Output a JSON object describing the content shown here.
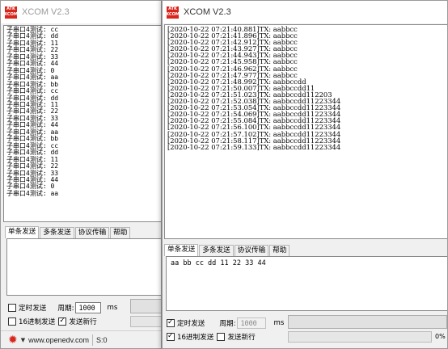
{
  "logo_text": "ATK\nXCOM",
  "window1": {
    "title": "XCOM V2.3",
    "receive_lines": [
      "子串口4测试: cc",
      "子串口4测试: dd",
      "子串口4测试: 11",
      "子串口4测试: 22",
      "子串口4测试: 33",
      "子串口4测试: 44",
      "子串口4测试: 0",
      "子串口4测试: aa",
      "子串口4测试: bb",
      "子串口4测试: cc",
      "子串口4测试: dd",
      "子串口4测试: 11",
      "子串口4测试: 22",
      "子串口4测试: 33",
      "子串口4测试: 44",
      "子串口4测试: aa",
      "子串口4测试: bb",
      "子串口4测试: cc",
      "子串口4测试: dd",
      "子串口4测试: 11",
      "子串口4测试: 22",
      "子串口4测试: 33",
      "子串口4测试: 44",
      "子串口4测试: 0",
      "子串口4测试: aa"
    ],
    "tabs": [
      "单条发送",
      "多条发送",
      "协议传输",
      "帮助"
    ],
    "send_text": "",
    "timed_send_label": "定时发送",
    "period_label": "周期:",
    "period_value": "1000",
    "period_unit": "ms",
    "hex_send_label": "16进制发送",
    "newline_label": "发送新行",
    "status": {
      "website": "www.openedv.com",
      "s_counter": "S:0"
    }
  },
  "window2": {
    "title": "XCOM V2.3",
    "receive_lines": [
      "[2020-10-22 07:21:40.881]TX: aabbcc",
      "[2020-10-22 07:21:41.896]TX: aabbcc",
      "[2020-10-22 07:21:42.912]TX: aabbcc",
      "[2020-10-22 07:21:43.927]TX: aabbcc",
      "[2020-10-22 07:21:44.943]TX: aabbcc",
      "[2020-10-22 07:21:45.958]TX: aabbcc",
      "[2020-10-22 07:21:46.962]TX: aabbcc",
      "[2020-10-22 07:21:47.977]TX: aabbcc",
      "[2020-10-22 07:21:48.992]TX: aabbccdd",
      "[2020-10-22 07:21:50.007]TX: aabbccdd11",
      "[2020-10-22 07:21:51.023]TX: aabbccdd112203",
      "[2020-10-22 07:21:52.038]TX: aabbccdd11223344",
      "[2020-10-22 07:21:53.054]TX: aabbccdd11223344",
      "[2020-10-22 07:21:54.069]TX: aabbccdd11223344",
      "[2020-10-22 07:21:55.084]TX: aabbccdd11223344",
      "[2020-10-22 07:21:56.100]TX: aabbccdd11223344",
      "[2020-10-22 07:21:57.102]TX: aabbccdd11223344",
      "[2020-10-22 07:21:58.117]TX: aabbccdd11223344",
      "[2020-10-22 07:21:59.133]TX: aabbccdd11223344"
    ],
    "tabs": [
      "单条发送",
      "多条发送",
      "协议传输",
      "帮助"
    ],
    "send_text": "aa bb cc dd 11 22 33 44",
    "timed_send_label": "定时发送",
    "period_label": "周期:",
    "period_value": "1000",
    "period_unit": "ms",
    "hex_send_label": "16进制发送",
    "newline_label": "发送新行",
    "progress_text": "0%"
  },
  "colors": {
    "brand_red": "#d9261c",
    "checked": "#000000"
  },
  "icons": {
    "logo": "atk-logo-icon",
    "gear": "gear-icon",
    "checkbox": "check-icon"
  }
}
